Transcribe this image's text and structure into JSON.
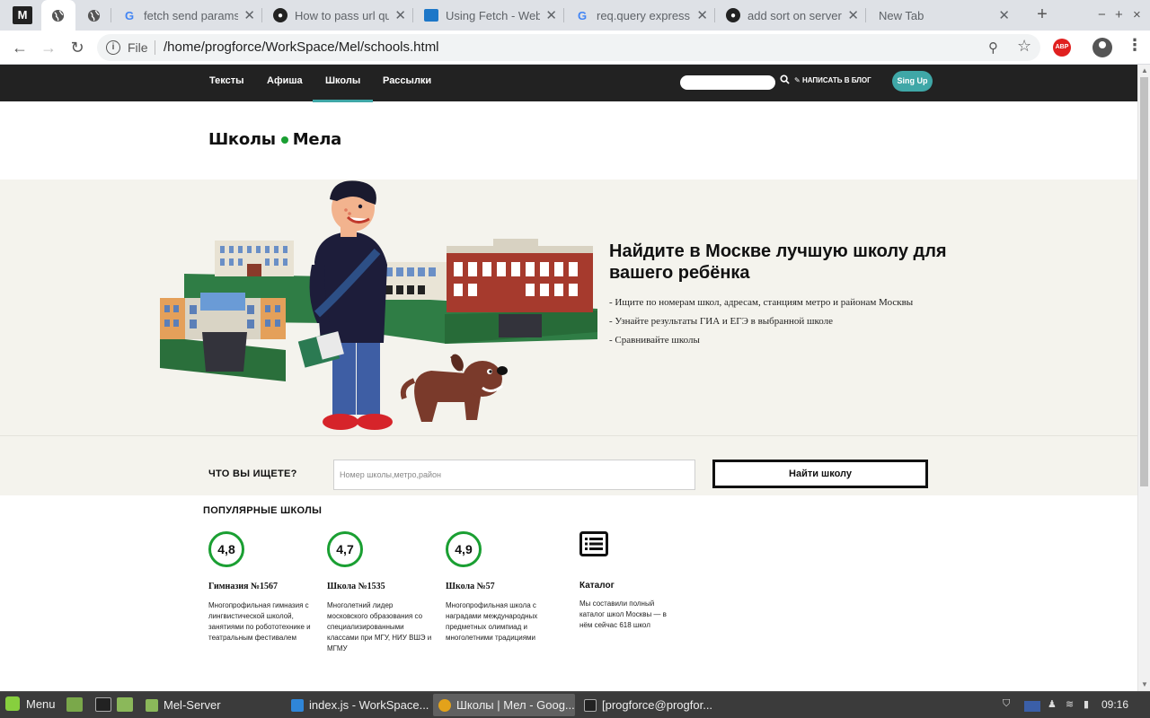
{
  "browser": {
    "app_mark": "M",
    "tabs": [
      {
        "title": "",
        "icon": "globe-icon",
        "active": true
      },
      {
        "title": "",
        "icon": "globe-icon",
        "active": false
      },
      {
        "title": "fetch send params",
        "icon": "google-icon"
      },
      {
        "title": "How to pass url qu",
        "icon": "github-icon"
      },
      {
        "title": "Using Fetch - Web",
        "icon": "mdn-icon"
      },
      {
        "title": "req.query express",
        "icon": "google-icon"
      },
      {
        "title": "add sort on server",
        "icon": "github-icon"
      },
      {
        "title": "New Tab",
        "icon": "none"
      }
    ],
    "new_tab_glyph": "+",
    "window_controls": [
      "−",
      "+",
      "×"
    ],
    "address": {
      "scheme_label": "File",
      "url": "/home/progforce/WorkSpace/Mel/schools.html"
    },
    "extension_label": "ABP"
  },
  "site": {
    "nav": [
      "Тексты",
      "Афиша",
      "Школы",
      "Рассылки"
    ],
    "active_nav_index": 2,
    "write_blog": "НАПИСАТЬ В БЛОГ",
    "signup": "Sing Up",
    "logo_left": "Школы",
    "logo_right": "Мела",
    "hero": {
      "title": "Найдите в Москве лучшую школу для вашего ребёнка",
      "bullets": [
        "- Ищите по номерам школ, адресам, станциям метро и районам Москвы",
        "- Узнайте результаты ГИА и ЕГЭ в выбранной школе",
        "- Сравнивайте школы"
      ]
    },
    "search": {
      "label": "ЧТО ВЫ ИЩЕТЕ?",
      "placeholder": "Номер школы,метро,район",
      "button": "Найти школу"
    },
    "popular": {
      "title": "ПОПУЛЯРНЫЕ ШКОЛЫ",
      "schools": [
        {
          "rating": "4,8",
          "name": "Гимназия №1567",
          "desc": "Многопрофильная гимназия с лингвистической школой, занятиями по робототехнике и театральным фестивалем"
        },
        {
          "rating": "4,7",
          "name": "Школа №1535",
          "desc": "Многолетний лидер московского образования со специализированными классами при МГУ, НИУ ВШЭ и МГМУ"
        },
        {
          "rating": "4,9",
          "name": "Школа №57",
          "desc": "Многопрофильная школа с наградами международных предметных олимпиад и многолетними традициями"
        }
      ],
      "catalog": {
        "icon": "list-icon",
        "name": "Каталог",
        "desc": "Мы составили полный каталог школ Москвы — в нём сейчас 618 школ"
      }
    },
    "colors": {
      "accent": "#3fa7a7",
      "rating_ring": "#1a9f32",
      "nav_bg": "#222222",
      "hero_bg": "#f4f3ed"
    }
  },
  "taskbar": {
    "menu_label": "Menu",
    "tasks": [
      "Mel-Server",
      "index.js - WorkSpace...",
      "Школы | Мел - Goog...",
      "[progforce@progfor..."
    ],
    "active_task_index": 2,
    "clock": "09:16"
  }
}
